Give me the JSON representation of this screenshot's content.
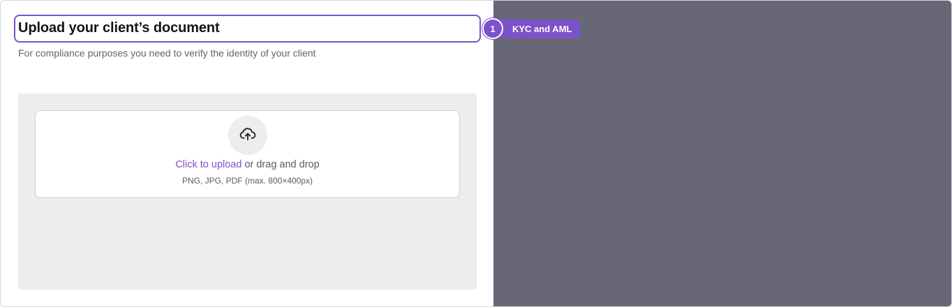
{
  "header": {
    "title": "Upload your client’s document",
    "subtitle": "For compliance purposes you need to verify the identity of your client"
  },
  "step": {
    "number": "1",
    "label": "KYC and AML"
  },
  "upload": {
    "link_label": "Click to upload",
    "rest_label": " or drag and drop",
    "hint": "PNG, JPG, PDF (max. 800×400px)",
    "icon": "cloud-upload-icon"
  },
  "colors": {
    "accent": "#7b52c9",
    "overlay": "#686778",
    "upload_area_bg": "#ededed"
  }
}
